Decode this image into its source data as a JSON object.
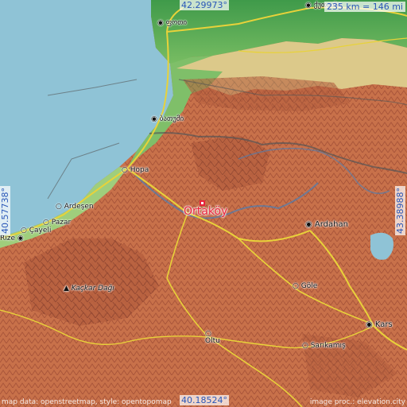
{
  "map": {
    "focus_place": "Ortaköy",
    "scale_label": "235 km = 146 mi",
    "coords": {
      "top": "42.29973°",
      "bottom": "40.18524°",
      "left": "40.57738°",
      "right": "43.38988°"
    },
    "places": [
      {
        "name": "ფოთი",
        "kind": "city"
      },
      {
        "name": "ბათუმი",
        "kind": "city"
      },
      {
        "name": "Hopa",
        "kind": "town"
      },
      {
        "name": "Ardeşen",
        "kind": "town"
      },
      {
        "name": "Pazar",
        "kind": "town"
      },
      {
        "name": "Çayeli",
        "kind": "town"
      },
      {
        "name": "Rize",
        "kind": "city"
      },
      {
        "name": "Kaçkar Dağı",
        "kind": "peak"
      },
      {
        "name": "Ardahan",
        "kind": "city"
      },
      {
        "name": "Göle",
        "kind": "town"
      },
      {
        "name": "Kars",
        "kind": "city"
      },
      {
        "name": "Oltu",
        "kind": "town"
      },
      {
        "name": "Sarıkamış",
        "kind": "town"
      },
      {
        "name": "ქუთაისი",
        "kind": "city",
        "partial": true
      }
    ],
    "attribution_left": "map data: openstreetmap, style: opentopomap",
    "attribution_right": "image proc.: elevation.city",
    "colors": {
      "sea": "#8fc3d6",
      "lowland": "#4fa653",
      "foothill": "#e4d79a",
      "mountain": "#c8714a",
      "road": "#e8d23a",
      "border": "#555555",
      "river": "#4a7fb5"
    }
  }
}
